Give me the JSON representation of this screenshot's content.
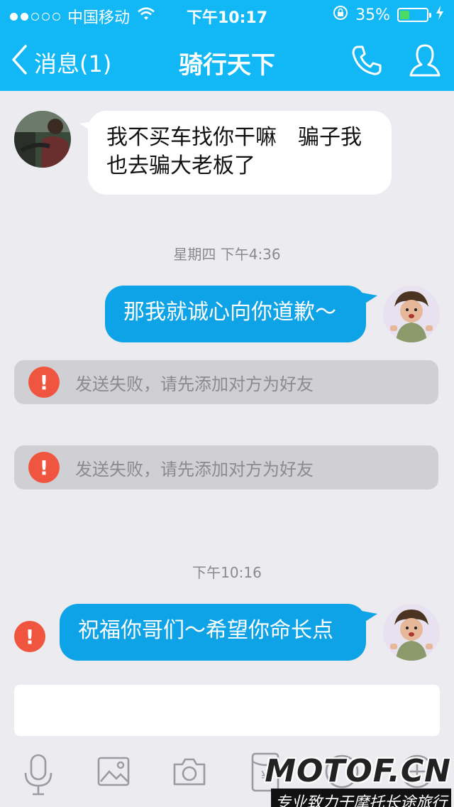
{
  "status_bar": {
    "carrier": "中国移动",
    "time": "下午10:17",
    "battery_percent": "35%",
    "battery_level": 0.35,
    "signal_bars_filled": 2,
    "signal_bars_total": 5
  },
  "nav": {
    "back_label": "消息(1)",
    "title": "骑行天下",
    "call_icon": "phone-icon",
    "profile_icon": "person-icon"
  },
  "messages": [
    {
      "direction": "in",
      "text_line1": "我不买车找你干嘛　骗子我",
      "text_line2": "也去骗大老板了"
    },
    {
      "direction": "out",
      "text": "那我就诚心向你道歉～"
    },
    {
      "direction": "out",
      "text": "祝福你哥们～希望你命长点",
      "failed": true
    }
  ],
  "timestamps": [
    "星期四 下午4:36",
    "下午10:16"
  ],
  "notices": [
    "发送失败，请先添加对方为好友",
    "发送失败，请先添加对方为好友"
  ],
  "error_glyph": "!",
  "input": {
    "value": ""
  },
  "toolbar": {
    "icons": [
      "microphone-icon",
      "image-icon",
      "camera-icon",
      "red-packet-icon",
      "emoji-icon",
      "plus-icon"
    ],
    "red_packet_symbol": "¥"
  },
  "watermark": {
    "logo": "MOTOF.CN",
    "tagline": "专业致力于摩托长途旅行"
  },
  "colors": {
    "accent": "#12b7f5",
    "bubble_out": "#0ea3e6",
    "error": "#f0563f",
    "battery": "#4cd964"
  }
}
